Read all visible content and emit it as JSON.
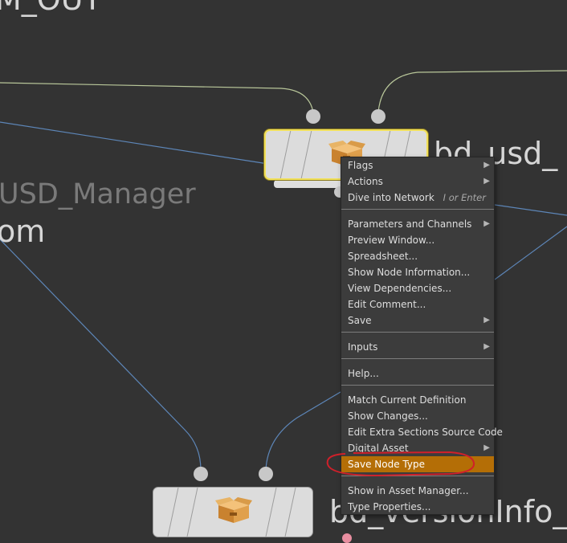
{
  "network": {
    "label_top_partial": "M_OUT",
    "label_usd_manager": "USD_Manager",
    "label_om": "om",
    "label_node_top": "bd_usd_",
    "label_node_bottom": "bd_versionInfo_"
  },
  "menu": {
    "items": [
      {
        "label": "Flags",
        "submenu": true
      },
      {
        "label": "Actions",
        "submenu": true
      },
      {
        "label": "Dive into Network",
        "shortcut": "I or Enter"
      },
      {
        "label": "Parameters and Channels",
        "submenu": true
      },
      {
        "label": "Preview Window..."
      },
      {
        "label": "Spreadsheet..."
      },
      {
        "label": "Show Node Information..."
      },
      {
        "label": "View Dependencies..."
      },
      {
        "label": "Edit Comment..."
      },
      {
        "label": "Save",
        "submenu": true
      },
      {
        "label": "Inputs",
        "submenu": true
      },
      {
        "label": "Help..."
      },
      {
        "label": "Match Current Definition"
      },
      {
        "label": "Show Changes..."
      },
      {
        "label": "Edit Extra Sections Source Code"
      },
      {
        "label": "Digital Asset",
        "submenu": true
      },
      {
        "label": "Save Node Type",
        "highlighted": true
      },
      {
        "label": "Show in Asset Manager..."
      },
      {
        "label": "Type Properties..."
      }
    ],
    "highlight_color": "#b46e06",
    "annotation_color": "#d0202a"
  },
  "icons": {
    "submenu_arrow": "triangle-right-icon",
    "node_icon": "box-package-icon"
  }
}
